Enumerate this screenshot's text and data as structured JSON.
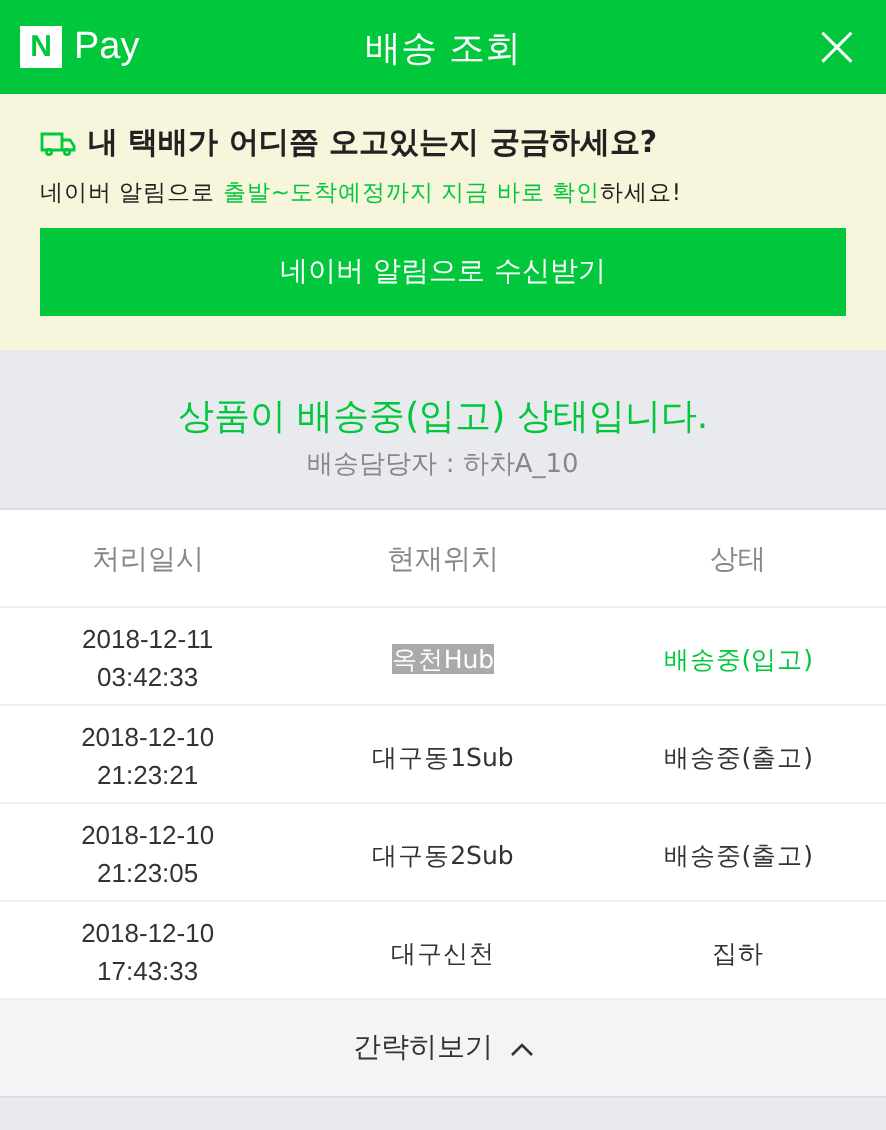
{
  "header": {
    "logo_mark": "N",
    "logo_text": "Pay",
    "title": "배송 조회",
    "close": "×"
  },
  "notice": {
    "headline": "내 택배가 어디쯤 오고있는지 궁금하세요?",
    "message": [
      {
        "text": "네이버 알림으로 ",
        "highlight": false
      },
      {
        "text": "출발~도착예정까지 지금 바로 확인",
        "highlight": true
      },
      {
        "text": "하세요!",
        "highlight": false
      }
    ],
    "button": "네이버 알림으로 수신받기"
  },
  "status": {
    "headline": "상품이 배송중(입고) 상태입니다.",
    "courier": "배송담당자 : 하차A_10"
  },
  "table": {
    "columns": [
      "처리일시",
      "현재위치",
      "상태"
    ],
    "rows": [
      {
        "date": "2018-12-11",
        "time": "03:42:33",
        "location": "옥천Hub",
        "status": "배송중(입고)",
        "current": true,
        "location_selected": true
      },
      {
        "date": "2018-12-10",
        "time": "21:23:21",
        "location": "대구동1Sub",
        "status": "배송중(출고)",
        "current": false,
        "location_selected": false
      },
      {
        "date": "2018-12-10",
        "time": "21:23:05",
        "location": "대구동2Sub",
        "status": "배송중(출고)",
        "current": false,
        "location_selected": false
      },
      {
        "date": "2018-12-10",
        "time": "17:43:33",
        "location": "대구신천",
        "status": "집하",
        "current": false,
        "location_selected": false
      }
    ]
  },
  "footer": {
    "toggle": "간략히보기",
    "expanded": true
  }
}
